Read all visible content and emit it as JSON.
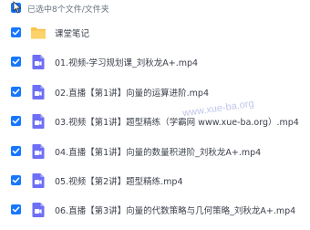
{
  "header": {
    "selection_label": "已选中8个文件/文件夹"
  },
  "items": [
    {
      "name": "课堂笔记",
      "type": "folder"
    },
    {
      "name": "01.视频-学习规划课_刘秋龙A+.mp4",
      "type": "video"
    },
    {
      "name": "02.直播【第1讲】向量的运算进阶.mp4",
      "type": "video"
    },
    {
      "name": "03.视频【第1讲】题型精练（学霸网 www.xue-ba.org）.mp4",
      "type": "video"
    },
    {
      "name": "04.直播【第1讲】向量的数量积进阶_刘秋龙A+.mp4",
      "type": "video"
    },
    {
      "name": "05.视频【第2讲】题型精练.mp4",
      "type": "video"
    },
    {
      "name": "06.直播【第3讲】向量的代数策略与几何策略_刘秋龙A+.mp4",
      "type": "video"
    }
  ],
  "watermark": "www.xue-ba.org",
  "colors": {
    "accent": "#1677ff",
    "video_icon": "#6e6ff5",
    "folder_icon": "#f7c24c"
  }
}
